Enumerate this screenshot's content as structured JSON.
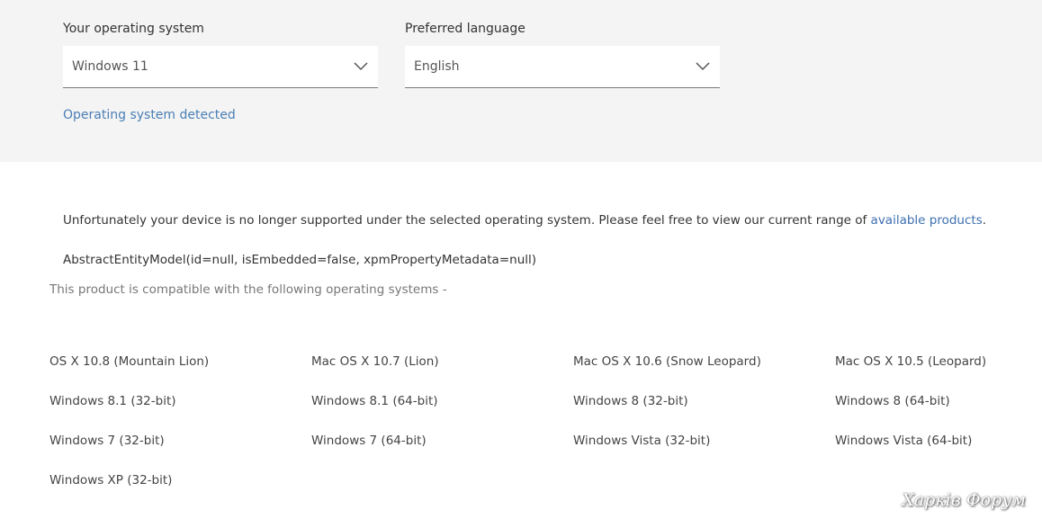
{
  "selectors": {
    "os_label": "Your operating system",
    "os_value": "Windows 11",
    "language_label": "Preferred language",
    "language_value": "English",
    "detected_text": "Operating system detected"
  },
  "notice": {
    "text": "Unfortunately your device is no longer supported under the selected operating system. Please feel free to view our current range of ",
    "link_text": "available products",
    "suffix": "."
  },
  "model_line": "AbstractEntityModel(id=null, isEmbedded=false, xpmPropertyMetadata=null)",
  "compat_heading": "This product is compatible with the following operating systems -",
  "os_list": [
    "OS X 10.8 (Mountain Lion)",
    "Mac OS X 10.7 (Lion)",
    "Mac OS X 10.6 (Snow Leopard)",
    "Mac OS X 10.5 (Leopard)",
    "Windows 8.1 (32-bit)",
    "Windows 8.1 (64-bit)",
    "Windows 8 (32-bit)",
    "Windows 8 (64-bit)",
    "Windows 7 (32-bit)",
    "Windows 7 (64-bit)",
    "Windows Vista (32-bit)",
    "Windows Vista (64-bit)",
    "Windows XP (32-bit)"
  ],
  "watermark": "Харків Форум",
  "colors": {
    "panel_bg": "#f4f4f4",
    "link": "#3d6fb0",
    "detected": "#4a7fb5"
  }
}
